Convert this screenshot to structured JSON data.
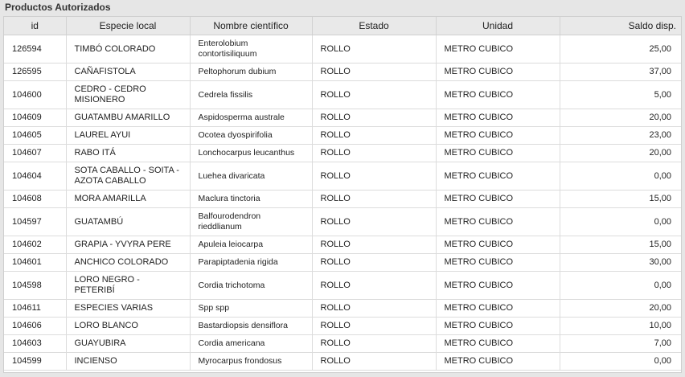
{
  "panel": {
    "title": "Productos Autorizados"
  },
  "table": {
    "headers": [
      "id",
      "Especie local",
      "Nombre científico",
      "Estado",
      "Unidad",
      "Saldo disp."
    ],
    "rows": [
      {
        "id": "126594",
        "especie": "TIMBÓ COLORADO",
        "nombre": "Enterolobium contortisiliquum",
        "estado": "ROLLO",
        "unidad": "METRO CUBICO",
        "saldo": "25,00",
        "tall": true
      },
      {
        "id": "126595",
        "especie": "CAÑAFISTOLA",
        "nombre": "Peltophorum dubium",
        "estado": "ROLLO",
        "unidad": "METRO CUBICO",
        "saldo": "37,00",
        "tall": false
      },
      {
        "id": "104600",
        "especie": "CEDRO - CEDRO MISIONERO",
        "nombre": "Cedrela fissilis",
        "estado": "ROLLO",
        "unidad": "METRO CUBICO",
        "saldo": "5,00",
        "tall": true
      },
      {
        "id": "104609",
        "especie": "GUATAMBU AMARILLO",
        "nombre": "Aspidosperma australe",
        "estado": "ROLLO",
        "unidad": "METRO CUBICO",
        "saldo": "20,00",
        "tall": false
      },
      {
        "id": "104605",
        "especie": "LAUREL AYUI",
        "nombre": "Ocotea dyospirifolia",
        "estado": "ROLLO",
        "unidad": "METRO CUBICO",
        "saldo": "23,00",
        "tall": false
      },
      {
        "id": "104607",
        "especie": "RABO ITÁ",
        "nombre": "Lonchocarpus leucanthus",
        "estado": "ROLLO",
        "unidad": "METRO CUBICO",
        "saldo": "20,00",
        "tall": false
      },
      {
        "id": "104604",
        "especie": "SOTA CABALLO - SOITA - AZOTA CABALLO",
        "nombre": "Luehea divaricata",
        "estado": "ROLLO",
        "unidad": "METRO CUBICO",
        "saldo": "0,00",
        "tall": true
      },
      {
        "id": "104608",
        "especie": "MORA AMARILLA",
        "nombre": "Maclura tinctoria",
        "estado": "ROLLO",
        "unidad": "METRO CUBICO",
        "saldo": "15,00",
        "tall": false
      },
      {
        "id": "104597",
        "especie": "GUATAMBÚ",
        "nombre": "Balfourodendron rieddlianum",
        "estado": "ROLLO",
        "unidad": "METRO CUBICO",
        "saldo": "0,00",
        "tall": true
      },
      {
        "id": "104602",
        "especie": "GRAPIA - YVYRA PERE",
        "nombre": "Apuleia leiocarpa",
        "estado": "ROLLO",
        "unidad": "METRO CUBICO",
        "saldo": "15,00",
        "tall": false
      },
      {
        "id": "104601",
        "especie": "ANCHICO COLORADO",
        "nombre": "Parapiptadenia rigida",
        "estado": "ROLLO",
        "unidad": "METRO CUBICO",
        "saldo": "30,00",
        "tall": false
      },
      {
        "id": "104598",
        "especie": "LORO NEGRO - PETERIBÍ",
        "nombre": "Cordia trichotoma",
        "estado": "ROLLO",
        "unidad": "METRO CUBICO",
        "saldo": "0,00",
        "tall": true
      },
      {
        "id": "104611",
        "especie": "ESPECIES VARIAS",
        "nombre": "Spp spp",
        "estado": "ROLLO",
        "unidad": "METRO CUBICO",
        "saldo": "20,00",
        "tall": false
      },
      {
        "id": "104606",
        "especie": "LORO BLANCO",
        "nombre": "Bastardiopsis densiflora",
        "estado": "ROLLO",
        "unidad": "METRO CUBICO",
        "saldo": "10,00",
        "tall": false
      },
      {
        "id": "104603",
        "especie": "GUAYUBIRA",
        "nombre": "Cordia americana",
        "estado": "ROLLO",
        "unidad": "METRO CUBICO",
        "saldo": "7,00",
        "tall": false
      },
      {
        "id": "104599",
        "especie": "INCIENSO",
        "nombre": "Myrocarpus frondosus",
        "estado": "ROLLO",
        "unidad": "METRO CUBICO",
        "saldo": "0,00",
        "tall": false
      }
    ]
  }
}
